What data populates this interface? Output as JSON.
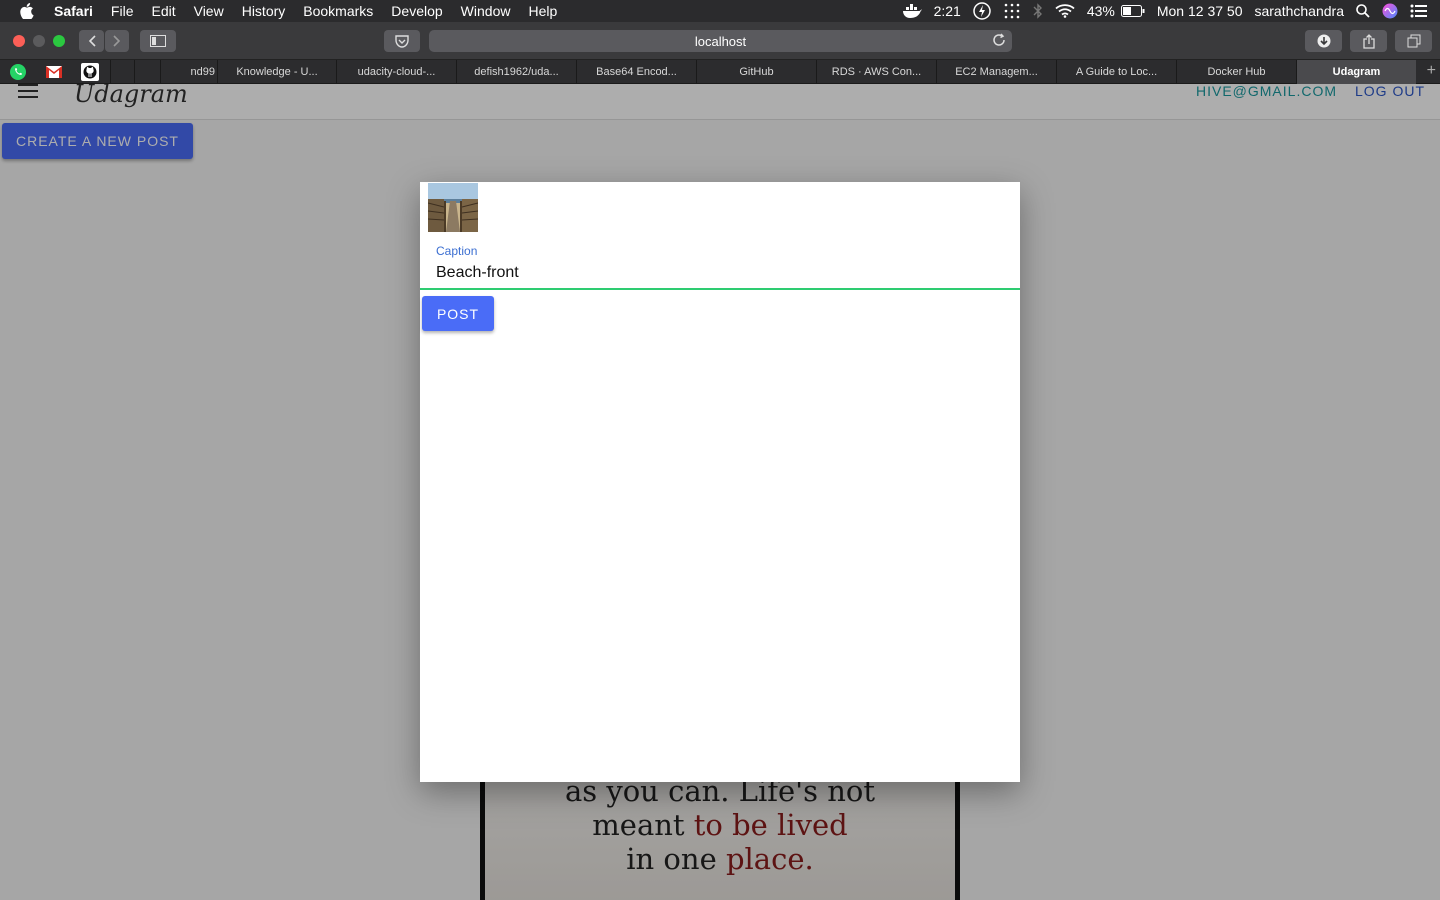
{
  "menubar": {
    "app": "Safari",
    "items": [
      "File",
      "Edit",
      "View",
      "History",
      "Bookmarks",
      "Develop",
      "Window",
      "Help"
    ],
    "time_short": "2:21",
    "battery": "43%",
    "clock": "Mon 12 37 50",
    "user": "sarathchandra"
  },
  "browser": {
    "address": "localhost",
    "tabs": [
      {
        "label": "nd99"
      },
      {
        "label": "Knowledge - U..."
      },
      {
        "label": "udacity-cloud-..."
      },
      {
        "label": "defish1962/uda..."
      },
      {
        "label": "Base64 Encod..."
      },
      {
        "label": "GitHub"
      },
      {
        "label": "RDS · AWS Con..."
      },
      {
        "label": "EC2 Managem..."
      },
      {
        "label": "A Guide to Loc..."
      },
      {
        "label": "Docker Hub"
      },
      {
        "label": "Udagram"
      }
    ]
  },
  "app": {
    "logo": "Udagram",
    "user_email": "HIVE@GMAIL.COM",
    "logout": "LOG OUT",
    "create_post": "CREATE A NEW POST",
    "feed_quote_1": "as you can. Life's not",
    "feed_quote_2a": "meant ",
    "feed_quote_2b": "to be lived",
    "feed_quote_3a": "in one ",
    "feed_quote_3b": "place."
  },
  "modal": {
    "caption_label": "Caption",
    "caption_value": "Beach-front",
    "post_button": "POST"
  },
  "colors": {
    "primary": "#4a6cf7",
    "email": "#1a9aa0",
    "input_underline": "#2ecc71"
  }
}
